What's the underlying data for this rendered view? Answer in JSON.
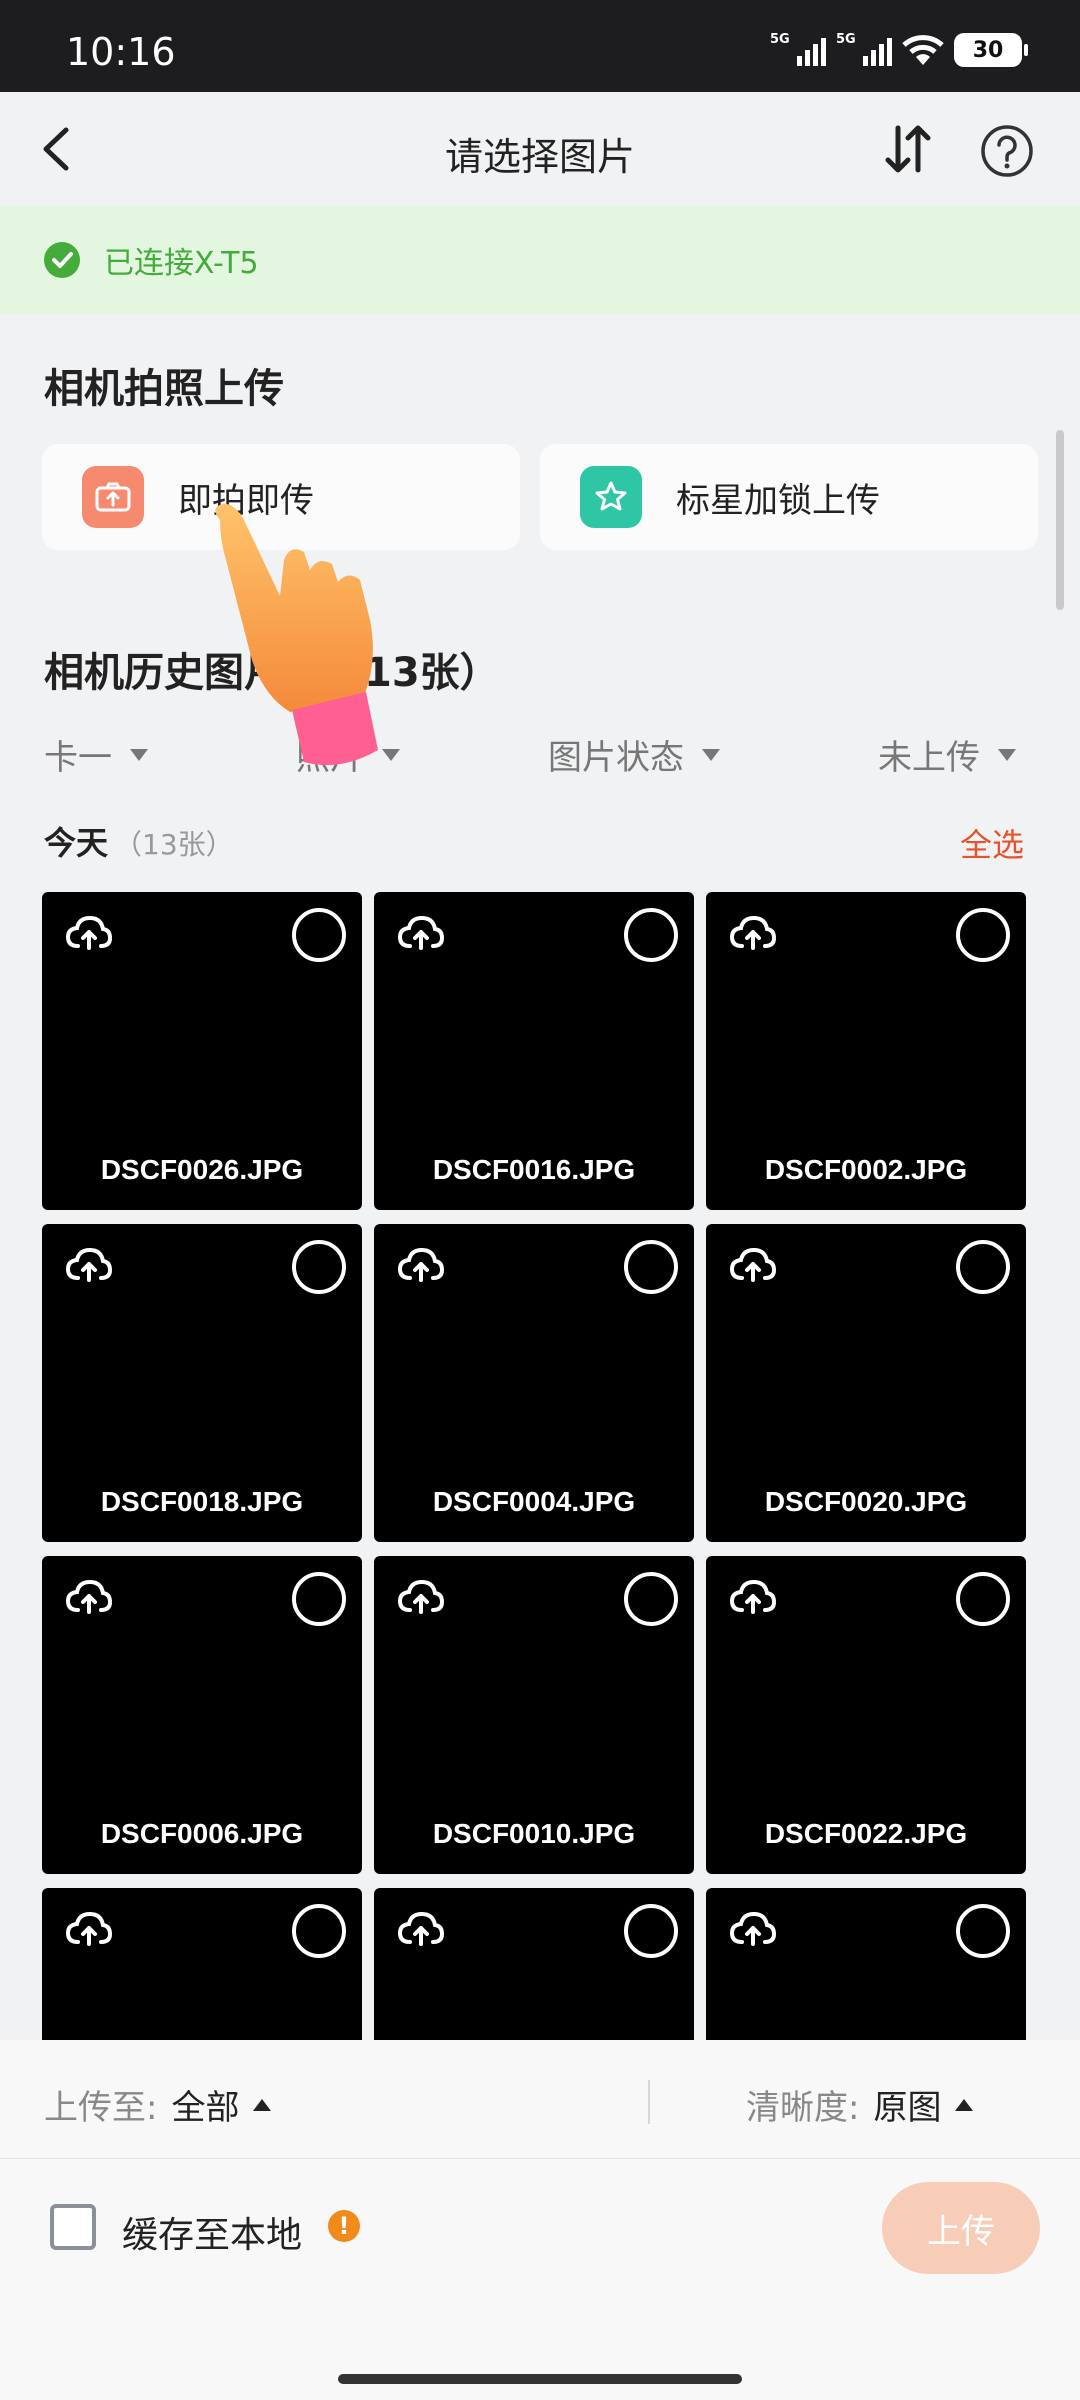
{
  "status_bar": {
    "time": "10:16",
    "network1": "5G",
    "network2": "5G",
    "battery": "30"
  },
  "header": {
    "title": "请选择图片"
  },
  "connection": {
    "text": "已连接X-T5"
  },
  "camera_upload": {
    "title": "相机拍照上传",
    "options": [
      {
        "label": "即拍即传",
        "icon": "camera-upload-icon",
        "color": "#f58a6e"
      },
      {
        "label": "标星加锁上传",
        "icon": "star-icon",
        "color": "#2ec6a4"
      }
    ]
  },
  "history": {
    "title": "相机历史图片（共13张）",
    "filters": [
      {
        "label": "卡一"
      },
      {
        "label": "照片"
      },
      {
        "label": "图片状态"
      },
      {
        "label": "未上传"
      }
    ],
    "group": {
      "date": "今天",
      "count": "（13张）",
      "select_all": "全选"
    },
    "photos": [
      "DSCF0026.JPG",
      "DSCF0016.JPG",
      "DSCF0002.JPG",
      "DSCF0018.JPG",
      "DSCF0004.JPG",
      "DSCF0020.JPG",
      "DSCF0006.JPG",
      "DSCF0010.JPG",
      "DSCF0022.JPG",
      "",
      "",
      ""
    ]
  },
  "bottom": {
    "upload_to_key": "上传至:",
    "upload_to_val": "全部",
    "quality_key": "清晰度:",
    "quality_val": "原图",
    "cache_label": "缓存至本地",
    "warn": "!",
    "upload_button": "上传"
  },
  "colors": {
    "accent": "#e8532d",
    "success": "#45ab3b",
    "upload_btn": "#f8cdb8"
  }
}
